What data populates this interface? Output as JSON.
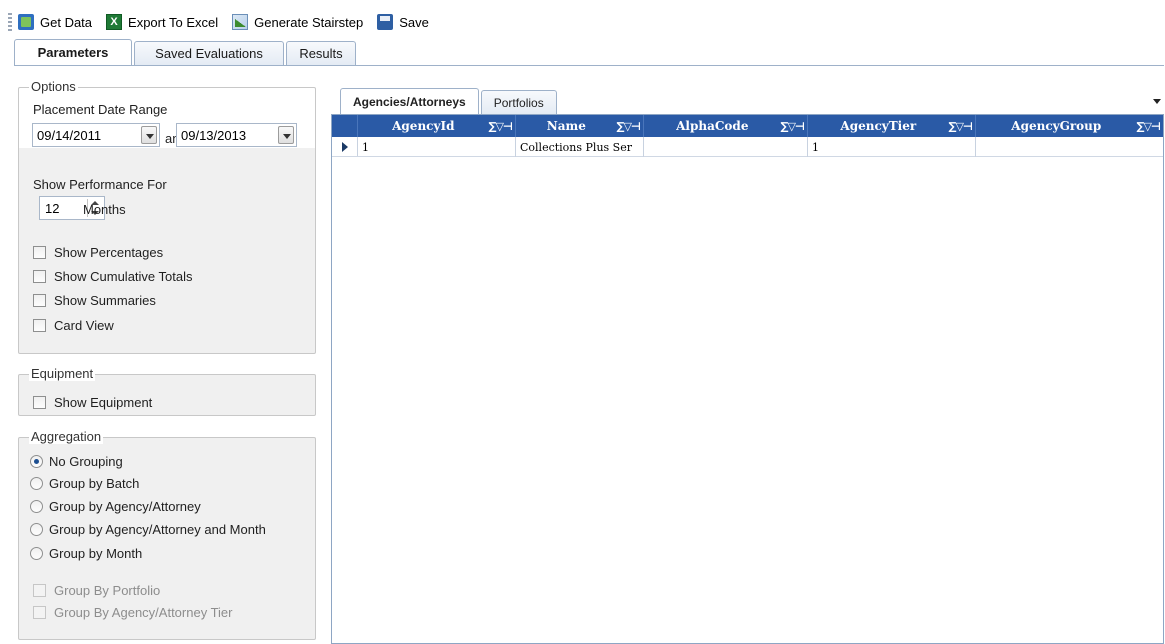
{
  "toolbar": {
    "get_data": "Get Data",
    "export_excel": "Export To Excel",
    "generate_stairstep": "Generate Stairstep",
    "save": "Save"
  },
  "main_tabs": [
    "Parameters",
    "Saved Evaluations",
    "Results"
  ],
  "options": {
    "title": "Options",
    "placement_label": "Placement Date Range",
    "date_from": "09/14/2011",
    "and_label": "and",
    "date_to": "09/13/2013",
    "show_perf_label": "Show Performance For",
    "months_value": "12",
    "months_label": "Months",
    "checkboxes": [
      "Show Percentages",
      "Show Cumulative Totals",
      "Show Summaries",
      "Card View"
    ]
  },
  "equipment": {
    "title": "Equipment",
    "show_equipment": "Show Equipment"
  },
  "aggregation": {
    "title": "Aggregation",
    "radios": [
      "No Grouping",
      "Group by Batch",
      "Group by Agency/Attorney",
      "Group by Agency/Attorney and Month",
      "Group by Month"
    ],
    "selected": "No Grouping",
    "disabled_checks": [
      "Group By Portfolio",
      "Group By Agency/Attorney Tier"
    ]
  },
  "sub_tabs": [
    "Agencies/Attorneys",
    "Portfolios"
  ],
  "grid": {
    "column_controls": "∑▽⊣",
    "columns": [
      "AgencyId",
      "Name",
      "AlphaCode",
      "AgencyTier",
      "AgencyGroup"
    ],
    "rows": [
      [
        "1",
        "Collections Plus Ser",
        "",
        "1",
        ""
      ]
    ]
  },
  "colors": {
    "grid_header": "#2a5aa6",
    "tab_border": "#9eb1c9"
  }
}
